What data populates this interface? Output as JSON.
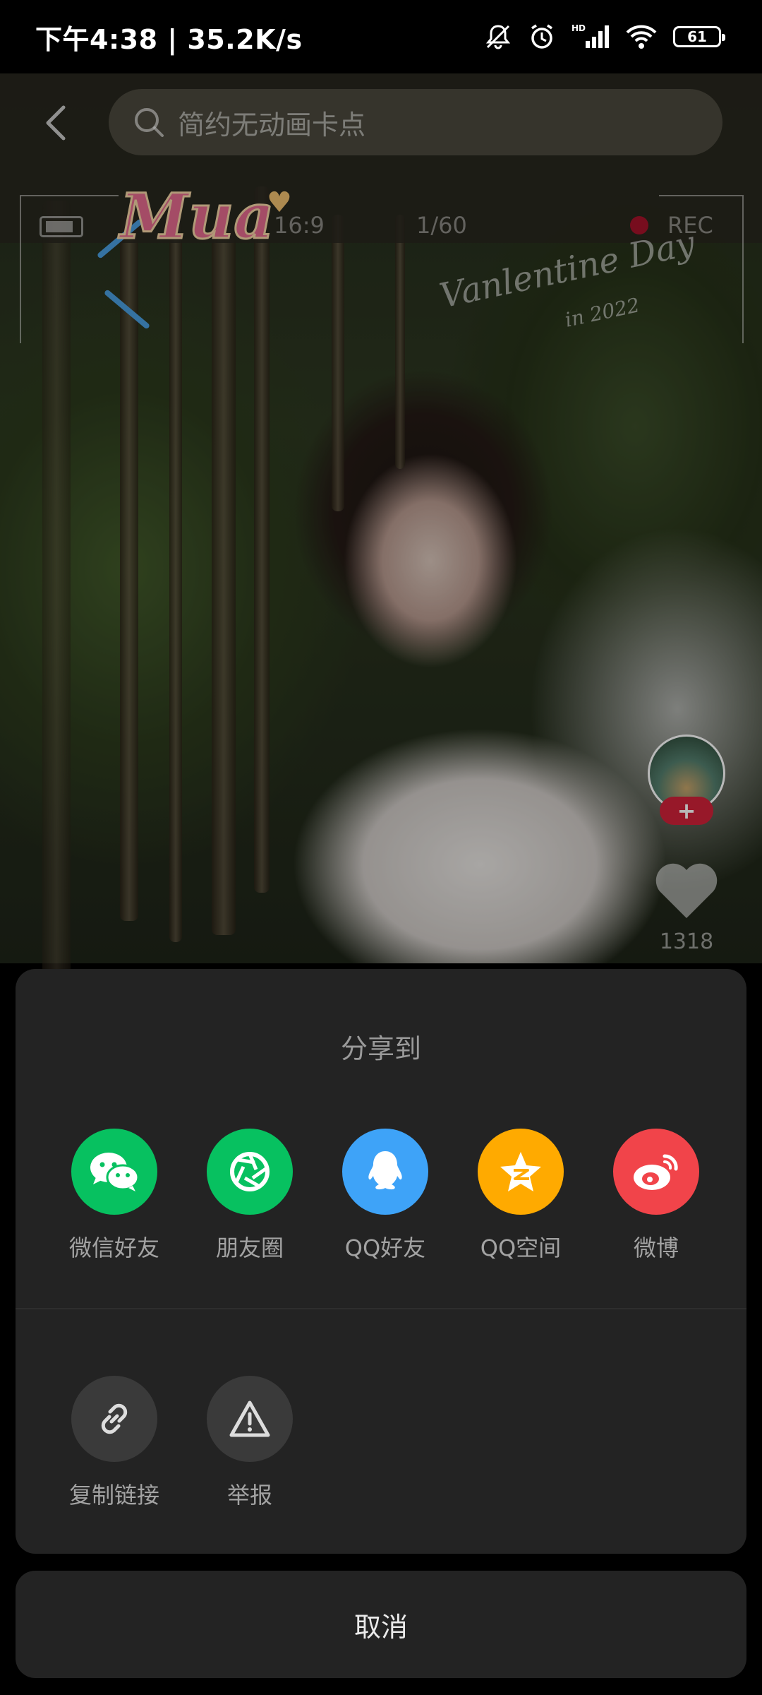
{
  "status_bar": {
    "time_speed": "下午4:38 | 35.2K/s",
    "battery": "61",
    "network_badge": "HD"
  },
  "top_bar": {
    "search_placeholder": "简约无动画卡点"
  },
  "video_overlay": {
    "ratio": "16:9",
    "shutter": "1/60",
    "rec": "REC",
    "sticker_text": "Mua",
    "script_text": "Vanlentine Day",
    "year_text": "in 2022"
  },
  "right_rail": {
    "like_count": "1318",
    "follow_symbol": "+"
  },
  "share_sheet": {
    "title": "分享到",
    "targets": [
      {
        "label": "微信好友",
        "icon": "wechat-icon",
        "color": "#07C160"
      },
      {
        "label": "朋友圈",
        "icon": "moments-icon",
        "color": "#07C160"
      },
      {
        "label": "QQ好友",
        "icon": "qq-icon",
        "color": "#3EA3F8"
      },
      {
        "label": "QQ空间",
        "icon": "qzone-icon",
        "color": "#FFAA00"
      },
      {
        "label": "微博",
        "icon": "weibo-icon",
        "color": "#F1444A"
      }
    ],
    "actions": [
      {
        "label": "复制链接",
        "icon": "link-icon"
      },
      {
        "label": "举报",
        "icon": "warning-icon"
      }
    ]
  },
  "cancel_label": "取消"
}
